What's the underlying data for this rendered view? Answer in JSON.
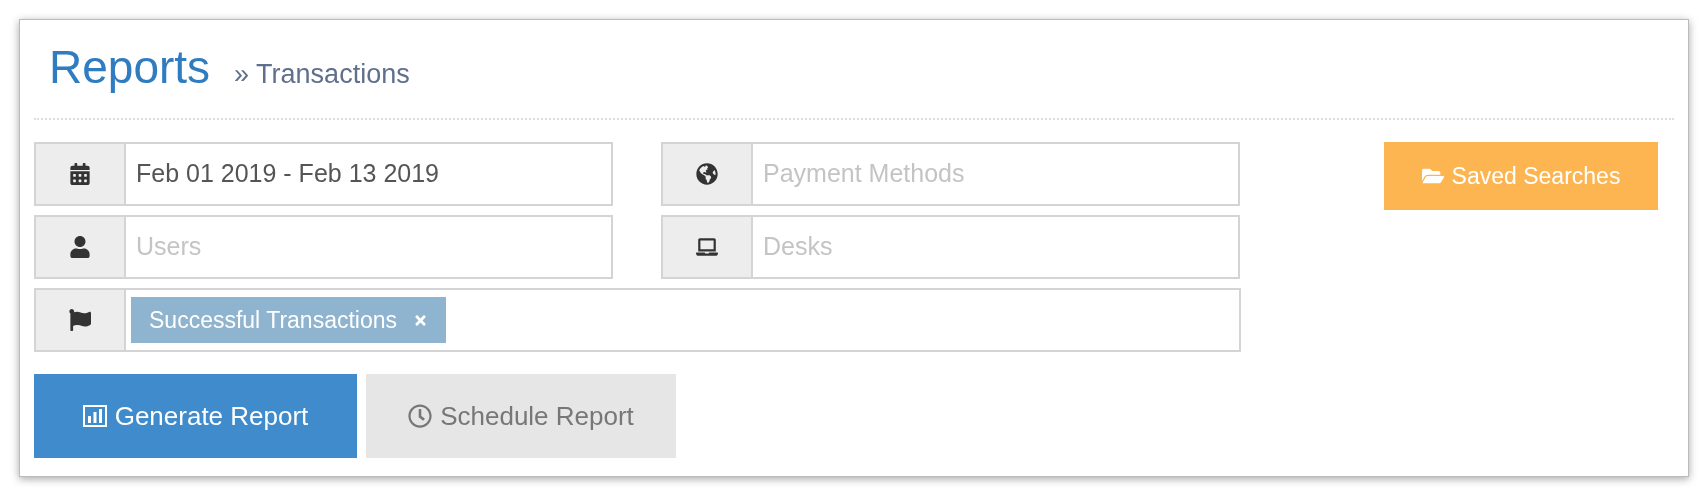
{
  "header": {
    "title": "Reports",
    "breadcrumb": "» Transactions"
  },
  "filter_rows": [
    [
      {
        "kind": "dates",
        "value": "Feb 01 2019 - Feb 13 2019"
      },
      {
        "kind": "payment",
        "placeholder": "Payment Methods"
      }
    ],
    [
      {
        "kind": "users",
        "placeholder": "Users"
      },
      {
        "kind": "desks",
        "placeholder": "Desks"
      }
    ]
  ],
  "status_filter": {
    "tags": [
      "Successful Transactions"
    ]
  },
  "saved_searches": {
    "label": "Saved Searches"
  },
  "actions": [
    {
      "kind": "primary",
      "label": "Generate Report"
    },
    {
      "kind": "secondary",
      "label": "Schedule Report"
    }
  ]
}
